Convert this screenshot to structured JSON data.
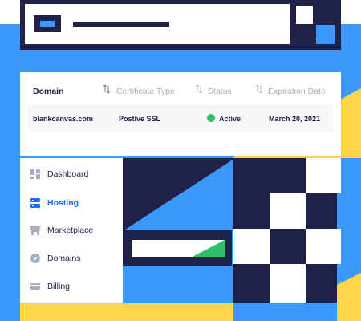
{
  "colors": {
    "navy": "#1f2148",
    "blue": "#3b99fc",
    "yellow": "#ffd54a",
    "green": "#2fbf6b",
    "active_blue": "#1a6fe8"
  },
  "header": {
    "logo_icon": "logo-square-icon"
  },
  "table": {
    "columns": [
      {
        "label": "Domain",
        "icon": "sort-icon"
      },
      {
        "label": "Certificate Type",
        "icon": "sort-icon"
      },
      {
        "label": "Status",
        "icon": "sort-icon"
      },
      {
        "label": "Expiration Date",
        "icon": "sort-icon"
      }
    ],
    "rows": [
      {
        "domain": "blankcanvas.com",
        "certificate_type": "Postive SSL",
        "status": "Active",
        "status_color": "#2fbf6b",
        "expiration_date": "March 20, 2021"
      }
    ]
  },
  "sidebar": {
    "items": [
      {
        "label": "Dashboard",
        "icon": "dashboard-grid-icon",
        "active": false
      },
      {
        "label": "Hosting",
        "icon": "server-icon",
        "active": true
      },
      {
        "label": "Marketplace",
        "icon": "store-icon",
        "active": false
      },
      {
        "label": "Domains",
        "icon": "compass-icon",
        "active": false
      },
      {
        "label": "Billing",
        "icon": "card-icon",
        "active": false
      }
    ]
  },
  "progress": {
    "fraction": 0.35,
    "fill_color": "#2fbf6b"
  }
}
